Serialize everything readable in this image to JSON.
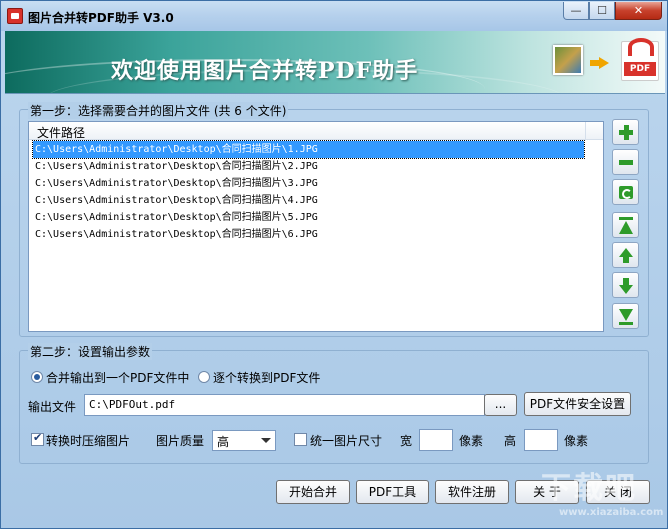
{
  "window": {
    "title": "图片合并转PDF助手 V3.0",
    "minimize_glyph": "—",
    "maximize_glyph": "☐",
    "close_glyph": "✕"
  },
  "banner": {
    "welcome": "欢迎使用图片合并转PDF助手",
    "pdf_badge": "PDF"
  },
  "step1": {
    "legend": "第一步：选择需要合并的图片文件 (共 6 个文件)",
    "column_header": "文件路径",
    "files": [
      "C:\\Users\\Administrator\\Desktop\\合同扫描图片\\1.JPG",
      "C:\\Users\\Administrator\\Desktop\\合同扫描图片\\2.JPG",
      "C:\\Users\\Administrator\\Desktop\\合同扫描图片\\3.JPG",
      "C:\\Users\\Administrator\\Desktop\\合同扫描图片\\4.JPG",
      "C:\\Users\\Administrator\\Desktop\\合同扫描图片\\5.JPG",
      "C:\\Users\\Administrator\\Desktop\\合同扫描图片\\6.JPG"
    ],
    "selected_index": 0,
    "tool_icons": [
      "add-icon",
      "remove-icon",
      "refresh-icon",
      "move-top-icon",
      "move-up-icon",
      "move-down-icon",
      "move-bottom-icon"
    ]
  },
  "step2": {
    "legend": "第二步：设置输出参数",
    "radio_merge_label": "合并输出到一个PDF文件中",
    "radio_merge_checked": true,
    "radio_each_label": "逐个转换到PDF文件",
    "output_label": "输出文件",
    "output_value": "C:\\PDFOut.pdf",
    "browse_label": "...",
    "security_label": "PDF文件安全设置",
    "compress_label": "转换时压缩图片",
    "compress_checked": true,
    "quality_label": "图片质量",
    "quality_value": "高",
    "uniform_label": "统一图片尺寸",
    "uniform_checked": false,
    "width_label": "宽",
    "width_unit": "像素",
    "height_label": "高",
    "height_unit": "像素"
  },
  "footer": {
    "start_label": "开始合并",
    "pdf_tools_label": "PDF工具",
    "register_label": "软件注册",
    "about_label": "关 于",
    "close_label": "关 闭"
  },
  "watermark": {
    "big": "下载吧",
    "small": "www.xiazaiba.com"
  },
  "colors": {
    "accent": "#3399ff",
    "tool_green": "#2e9b2a",
    "window_bg": "#b3cfe9"
  }
}
